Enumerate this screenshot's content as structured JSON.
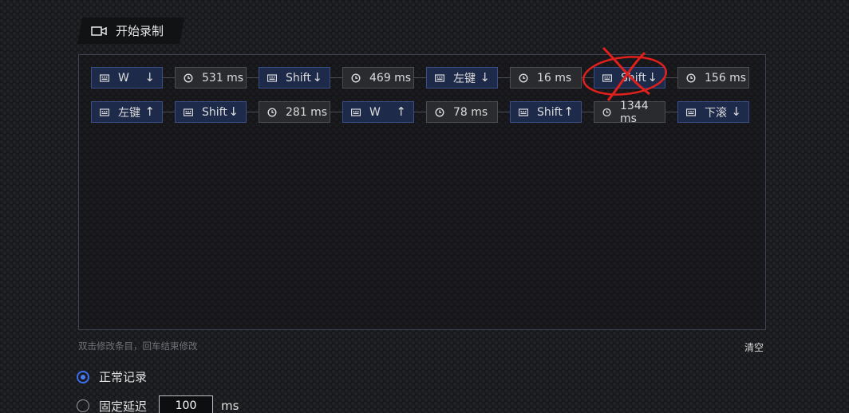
{
  "record_button": {
    "label": "开始录制",
    "icon": "video-camera-icon"
  },
  "sequence": [
    {
      "kind": "key",
      "label": "W",
      "arrow": "↓"
    },
    {
      "kind": "delay",
      "label": "531 ms"
    },
    {
      "kind": "key",
      "label": "Shift",
      "arrow": "↓"
    },
    {
      "kind": "delay",
      "label": "469 ms"
    },
    {
      "kind": "key",
      "label": "左键",
      "arrow": "↓"
    },
    {
      "kind": "delay",
      "label": "16 ms"
    },
    {
      "kind": "key",
      "label": "Shift",
      "arrow": "↓",
      "crossed_out": true
    },
    {
      "kind": "delay",
      "label": "156 ms"
    },
    {
      "kind": "key",
      "label": "左键",
      "arrow": "↑"
    },
    {
      "kind": "key",
      "label": "Shift",
      "arrow": "↓"
    },
    {
      "kind": "delay",
      "label": "281 ms"
    },
    {
      "kind": "key",
      "label": "W",
      "arrow": "↑"
    },
    {
      "kind": "delay",
      "label": "78 ms"
    },
    {
      "kind": "key",
      "label": "Shift",
      "arrow": "↑"
    },
    {
      "kind": "delay",
      "label": "1344 ms"
    },
    {
      "kind": "key",
      "label": "下滚",
      "arrow": "↓"
    }
  ],
  "hint": "双击修改条目，回车结束修改",
  "clear_label": "清空",
  "modes": {
    "normal": {
      "label": "正常记录",
      "selected": true
    },
    "fixed": {
      "label": "固定延迟",
      "selected": false,
      "value": "100",
      "unit": "ms"
    }
  },
  "annotation_color": "#e0201c"
}
